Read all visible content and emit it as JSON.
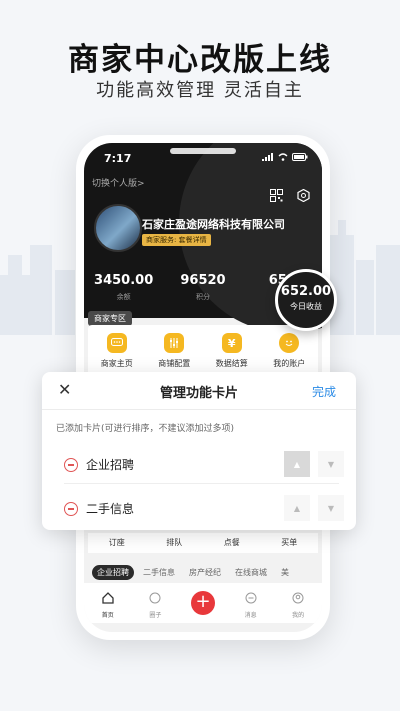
{
  "headline": "商家中心改版上线",
  "subline": "功能高效管理 灵活自主",
  "status": {
    "time": "7:17"
  },
  "header": {
    "switch_label": "切换个人版>",
    "company": "石家庄盈途网络科技有限公司",
    "tag": "商家服务: 套餐详情"
  },
  "stats": [
    {
      "value": "3450.00",
      "label": "余额"
    },
    {
      "value": "96520",
      "label": "积分"
    },
    {
      "value": "652",
      "label": "今"
    }
  ],
  "bubble": {
    "value": "652.00",
    "label": "今日收益"
  },
  "zone": {
    "label": "商家专区",
    "items": [
      {
        "label": "商家主页",
        "icon": "chat-icon"
      },
      {
        "label": "商铺配置",
        "icon": "sliders-icon"
      },
      {
        "label": "数据结算",
        "icon": "yen-icon"
      },
      {
        "label": "我的账户",
        "icon": "smile-icon"
      }
    ]
  },
  "lower_row": [
    "订座",
    "排队",
    "点餐",
    "买单"
  ],
  "category_tabs": [
    "企业招聘",
    "二手信息",
    "房产经纪",
    "在线商城",
    "美"
  ],
  "bottom_nav": [
    {
      "label": "首页",
      "icon": "home-icon"
    },
    {
      "label": "圈子",
      "icon": "circle-icon"
    },
    {
      "label": "",
      "icon": "plus-icon"
    },
    {
      "label": "消息",
      "icon": "message-icon"
    },
    {
      "label": "我的",
      "icon": "user-icon"
    }
  ],
  "sheet": {
    "title": "管理功能卡片",
    "done": "完成",
    "hint": "已添加卡片(可进行排序，不建议添加过多项)",
    "rows": [
      {
        "label": "企业招聘"
      },
      {
        "label": "二手信息"
      }
    ]
  },
  "colors": {
    "accent": "#f5b821",
    "done": "#2b8be6",
    "delete": "#e05555",
    "plus": "#e8383b"
  }
}
